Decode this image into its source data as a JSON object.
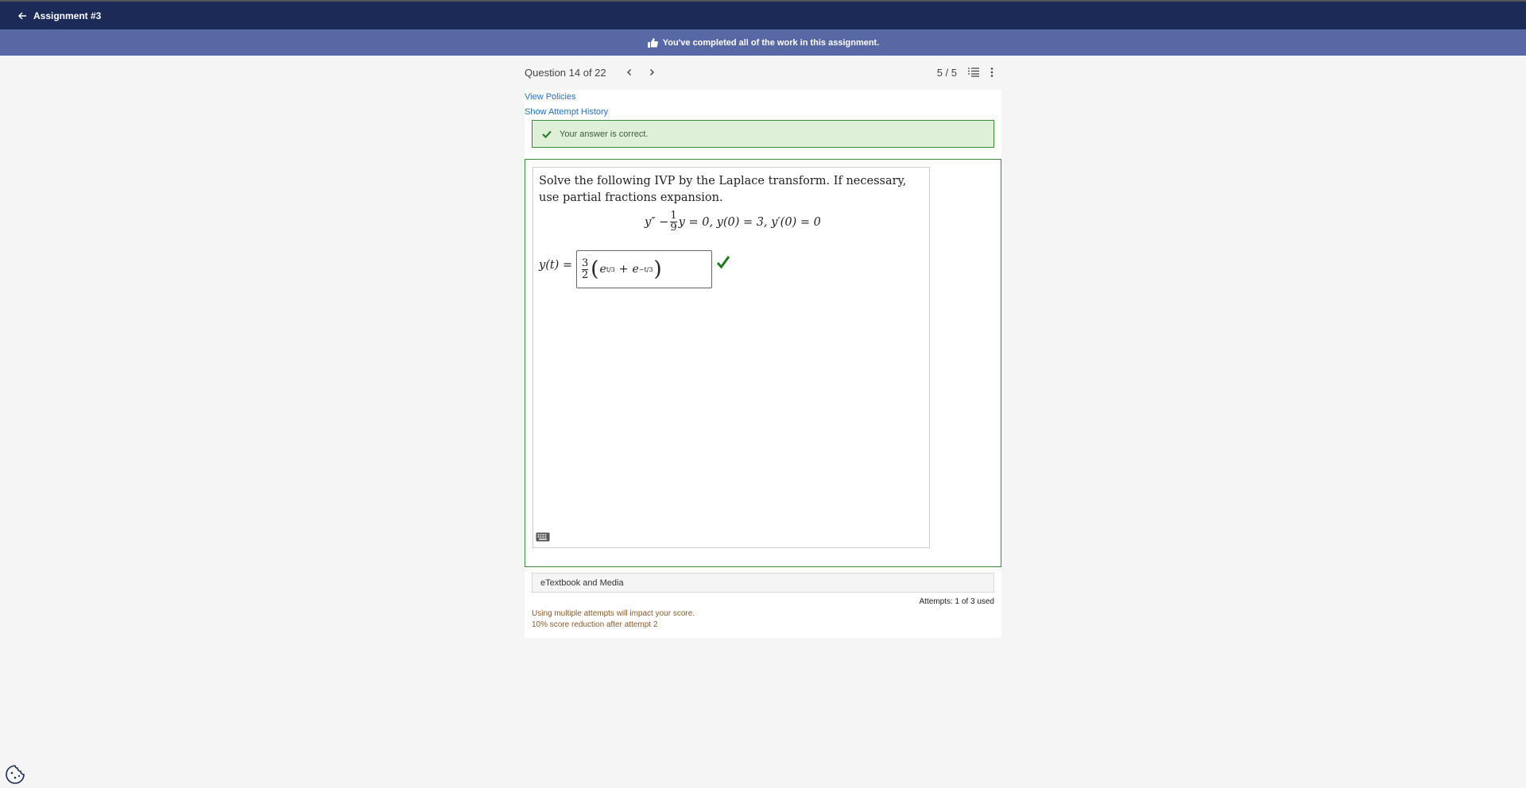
{
  "topbar": {
    "back_label": "Assignment #3"
  },
  "banner": {
    "text": "You've completed all of the work in this assignment."
  },
  "question_header": {
    "label": "Question 14 of 22",
    "score": "5 / 5"
  },
  "links": {
    "view_policies": "View Policies",
    "attempt_history": "Show Attempt History"
  },
  "feedback": {
    "text": "Your answer is correct."
  },
  "question": {
    "prompt": "Solve the following IVP by the Laplace transform. If necessary, use partial fractions expansion.",
    "equation_lhs": "y″ −",
    "fraction_num": "1",
    "fraction_den": "9",
    "equation_rhs": "y = 0, y(0) = 3, y′(0) = 0",
    "answer_lhs": "y(t) =",
    "answer_coef_num": "3",
    "answer_coef_den": "2",
    "answer_term1": "e",
    "answer_exp1": "t/3",
    "answer_plus": "+",
    "answer_term2": "e",
    "answer_exp2": "−t/3"
  },
  "etextbook": {
    "label": "eTextbook and Media"
  },
  "attempts": {
    "label": "Attempts: 1 of 3 used"
  },
  "notes": {
    "line1": "Using multiple attempts will impact your score.",
    "line2": "10% score reduction after attempt 2"
  },
  "colors": {
    "topbar": "#1b2a57",
    "banner": "#5868a4",
    "success_bg": "#dff0d8",
    "success_border": "#3c8a3c",
    "link": "#2a6ebb"
  },
  "icons": [
    "arrow-left-icon",
    "thumbs-up-icon",
    "chevron-left-icon",
    "chevron-right-icon",
    "list-icon",
    "more-vertical-icon",
    "check-icon",
    "keyboard-icon",
    "cookie-icon"
  ]
}
